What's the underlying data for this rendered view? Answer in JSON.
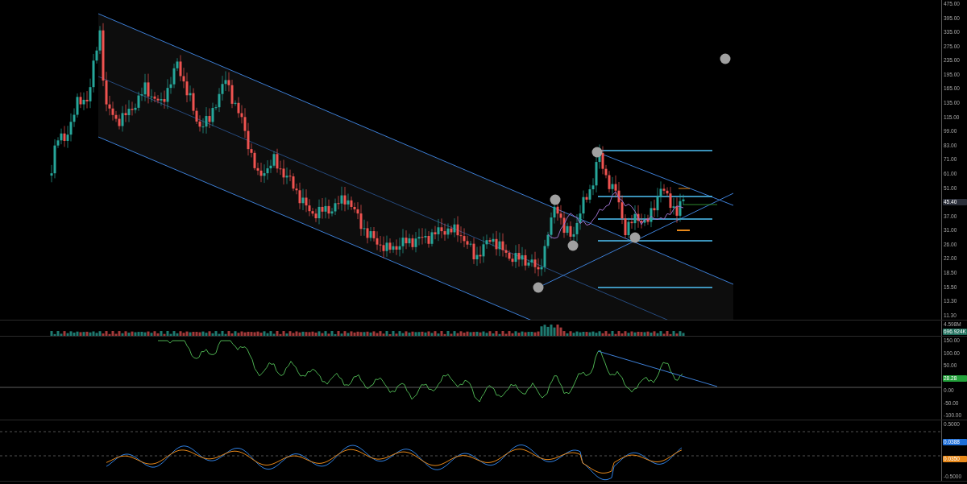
{
  "panes": [
    {
      "kind": "price",
      "axis": [
        {
          "kind": "tick",
          "text": "475.00"
        },
        {
          "kind": "tick",
          "text": "395.00"
        },
        {
          "kind": "tick",
          "text": "335.00"
        },
        {
          "kind": "tick",
          "text": "275.00"
        },
        {
          "kind": "tick",
          "text": "235.00"
        },
        {
          "kind": "tick",
          "text": "195.00"
        },
        {
          "kind": "tick",
          "text": "165.00"
        },
        {
          "kind": "tick",
          "text": "135.00"
        },
        {
          "kind": "tick",
          "text": "115.00"
        },
        {
          "kind": "tick",
          "text": "99.00"
        },
        {
          "kind": "tick",
          "text": "83.00"
        },
        {
          "kind": "tick",
          "text": "71.00"
        },
        {
          "kind": "tick",
          "text": "61.00"
        },
        {
          "kind": "tick",
          "text": "51.00"
        },
        {
          "kind": "badge",
          "text": "45.40",
          "color": "#2a2e39"
        },
        {
          "kind": "tick",
          "text": "37.00"
        },
        {
          "kind": "tick",
          "text": "31.00"
        },
        {
          "kind": "tick",
          "text": "26.00"
        },
        {
          "kind": "tick",
          "text": "22.00"
        },
        {
          "kind": "tick",
          "text": "18.50"
        },
        {
          "kind": "tick",
          "text": "15.50"
        },
        {
          "kind": "tick",
          "text": "13.30"
        },
        {
          "kind": "tick",
          "text": "11.30"
        }
      ]
    },
    {
      "kind": "volume",
      "axis": [
        {
          "kind": "tick",
          "text": "4.598M"
        },
        {
          "kind": "badge",
          "text": "696.924K",
          "color": "#1f6f5c"
        }
      ]
    },
    {
      "kind": "oscillator",
      "axis": [
        {
          "kind": "tick",
          "text": "150.00"
        },
        {
          "kind": "tick",
          "text": "100.00"
        },
        {
          "kind": "tick",
          "text": "50.00"
        },
        {
          "kind": "badge",
          "text": "28.28",
          "color": "#22a03a"
        },
        {
          "kind": "tick",
          "text": "0.00"
        },
        {
          "kind": "tick",
          "text": "-50.00"
        },
        {
          "kind": "tick",
          "text": "-100.00"
        }
      ]
    },
    {
      "kind": "signal",
      "axis": [
        {
          "kind": "tick",
          "text": "0.5000"
        },
        {
          "kind": "badge",
          "text": "0.0388",
          "color": "#1e6fd9"
        },
        {
          "kind": "badge",
          "text": "0.0350",
          "color": "#e8891a"
        },
        {
          "kind": "tick",
          "text": "-0.5000"
        }
      ]
    }
  ]
}
